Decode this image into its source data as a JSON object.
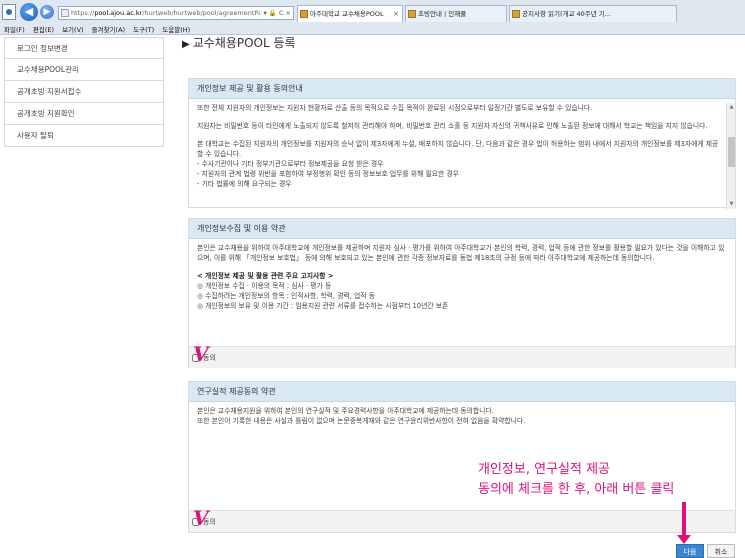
{
  "browser": {
    "url_prefix": "https://",
    "url_domain": "pool.ajou.ac.kr",
    "url_path": "/hurtweb/hurtweb/pool/agreementPage.ac",
    "url_tools": "▾ 🔒 C ×",
    "tabs": [
      {
        "label": "아주대학교 교수채용POOL",
        "active": true
      },
      {
        "label": "초빙안내 | 인재풀",
        "active": false
      },
      {
        "label": "공지사항 읽기(개교 40주년 기...",
        "active": false
      }
    ],
    "menu": [
      "파일(F)",
      "편집(E)",
      "보기(V)",
      "즐겨찾기(A)",
      "도구(T)",
      "도움말(H)"
    ]
  },
  "sidebar": {
    "items": [
      {
        "label": "로그인 정보변경"
      },
      {
        "label": "교수채용POOL관리"
      },
      {
        "label": "공개초빙 지원서접수"
      },
      {
        "label": "공개초빙 지원확인"
      },
      {
        "label": "사용자 탈퇴"
      }
    ]
  },
  "page": {
    "title": "교수채용POOL 등록"
  },
  "privacy_notice": {
    "title": "개인정보 제공 및 활용 동의안내",
    "p1": "또한 전체 지원자의 개인정보는 지원자 현황자료 산출 등의 목적으로 수집 목적이 완료된 시점으로부터 일정기간 별도로 보유할 수 있습니다.",
    "p2": "지원자는 비밀번호 등이 타인에게 노출되지 않도록 철저히 관리해야 하며, 비밀번호 관리 소홀 등 지원자 자신의 귀책사유로 인해 노출된 정보에 대해서 학교는 책임을 지지 않습니다.",
    "p3": "본 대학교는 수집된 지원자의 개인정보를 지원자의 승낙 없이 제3자에게 누설, 배포하지 않습니다. 단, 다음과 같은 경우 법이 허용하는 범위 내에서 지원자의 개인정보를 제3자에게 제공할 수 있습니다.",
    "li1": "- 수사기관이나 기타 정부기관으로부터 정보제공을 요청 받은 경우",
    "li2": "- 지원자의 관계 법령 위반을 포함하여 부정행위 확인 등의 정보보호 업무를 위해 필요한 경우",
    "li3": "- 기타 법률에 의해 요구되는 경우"
  },
  "privacy_terms": {
    "title": "개인정보수집 및 이용 약관",
    "p1": "본인은 교수채용을 위하여 아주대학교에 개인정보를 제공하며 지원자 심사 · 평가를 위하여 아주대학교가 본인의 학력, 경력, 업적 등에 관한 정보를 활용할 필요가 있다는 것을 이해하고 있으며, 이를 위해 「개인정보 보호법」 등에 의해 보호되고 있는 본인에 관한 각종 정보자료를 동법 제18조의 규정 등에 따라 아주대학교에 제공하는데 동의합니다.",
    "heading": "< 개인정보 제공 및 활용 관련 주요 고지사항 >",
    "b1": "◎ 개인정보 수집 · 이용의 목적 : 심사 · 평가 등",
    "b2": "◎ 수집하려는 개인정보의 항목 : 인적사항, 학력, 경력, 업적 등",
    "b3": "◎ 개인정보의 보유 및 이용 기간 : 임용지원 관련 서류를 접수하는 시점부터 10년간 보존",
    "agree_label": "동의"
  },
  "research_terms": {
    "title": "연구실적 제공동의 약관",
    "p1": "본인은 교수채용지원을 위하여 본인의 연구실적 및 주요경력사항을 아주대학교에 제공하는데 동의합니다.",
    "p2": "또한 본인이 기록한 내용은 사실과 틀림이 없으며 논문중복게재와 같은 연구윤리위반사항이 전혀 없음을 확약합니다.",
    "agree_label": "동의"
  },
  "annotation": {
    "mark1": "V",
    "mark2": "V",
    "line1": "개인정보, 연구실적 제공",
    "line2": "동의에 체크를  한 후, 아래 버튼 클릭"
  },
  "buttons": {
    "next": "다음",
    "cancel": "취소"
  },
  "colors": {
    "annotation": "#e0107a",
    "panel_header": "#d9e9f3",
    "next_button": "#3b86cf"
  }
}
